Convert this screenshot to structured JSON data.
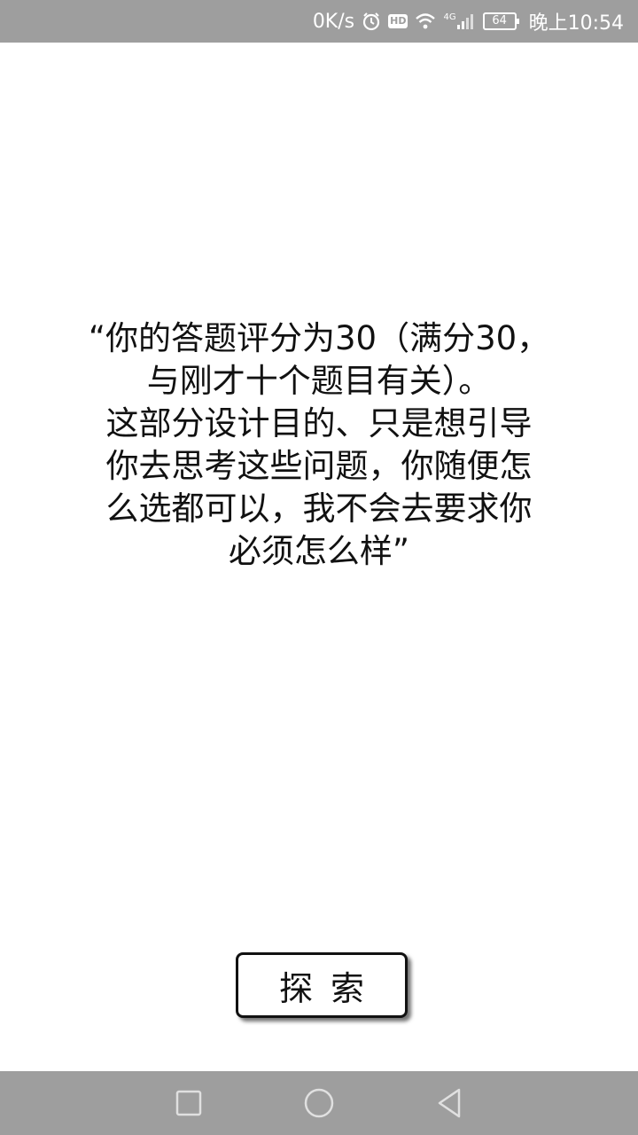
{
  "status_bar": {
    "net_speed": "0K/s",
    "hd": "HD",
    "network_type": "4G",
    "battery": "64",
    "time": "晚上10:54",
    "icons": [
      "alarm-icon",
      "wifi-icon",
      "signal-icon",
      "battery-icon"
    ]
  },
  "main": {
    "message_lines": [
      "“你的答题评分为30（满分30，",
      "与刚才十个题目有关）。",
      "这部分设计目的、只是想引导",
      "你去思考这些问题，你随便怎",
      "么选都可以，我不会去要求你",
      "必须怎么样”"
    ],
    "explore_button_label": "探索"
  },
  "nav_bar": {
    "icons": [
      "recent-apps-icon",
      "home-icon",
      "back-icon"
    ]
  }
}
